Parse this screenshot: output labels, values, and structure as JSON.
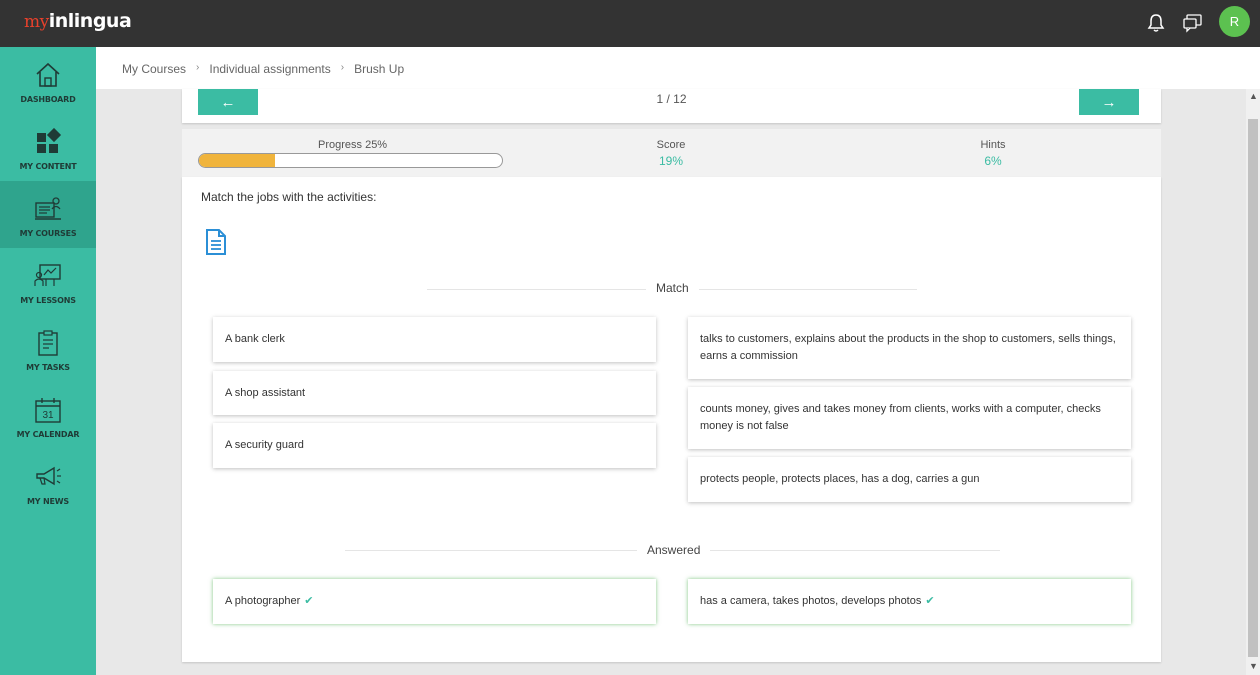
{
  "app": {
    "logo_prefix": "my",
    "logo_name": "inlingua",
    "avatar_initial": "R"
  },
  "sidebar": {
    "items": [
      {
        "label": "DASHBOARD",
        "icon": "home-icon"
      },
      {
        "label": "MY CONTENT",
        "icon": "grid-icon"
      },
      {
        "label": "MY COURSES",
        "icon": "courses-icon",
        "active": true
      },
      {
        "label": "MY LESSONS",
        "icon": "lessons-icon"
      },
      {
        "label": "MY TASKS",
        "icon": "tasks-icon"
      },
      {
        "label": "MY CALENDAR",
        "icon": "calendar-icon"
      },
      {
        "label": "MY NEWS",
        "icon": "megaphone-icon"
      }
    ],
    "calendar_day": "31"
  },
  "breadcrumb": [
    "My Courses",
    "Individual assignments",
    "Brush Up"
  ],
  "nav": {
    "prev_label": "←",
    "next_label": "→",
    "pager": "1 / 12"
  },
  "stats": {
    "progress_label": "Progress 25%",
    "progress_value": 0.25,
    "score_label": "Score",
    "score_value": "19%",
    "hints_label": "Hints",
    "hints_value": "6%"
  },
  "exercise": {
    "instruction": "Match the jobs with the activities:",
    "match_title": "Match",
    "answered_title": "Answered",
    "jobs": [
      "A bank clerk",
      "A shop assistant",
      "A security guard"
    ],
    "activities": [
      "talks to customers, explains about the products in the shop to customers, sells things, earns a commission",
      "counts money, gives and takes money from clients, works with a computer, checks money is not false",
      "protects people, protects places, has a dog, carries a gun"
    ],
    "answered_job": "A photographer",
    "answered_activity": "has a camera, takes photos, develops photos",
    "check_mark": "✔"
  },
  "colors": {
    "accent": "#3bbca3",
    "progress": "#f0b43c",
    "topbar": "#333333",
    "avatar": "#5cc150"
  }
}
